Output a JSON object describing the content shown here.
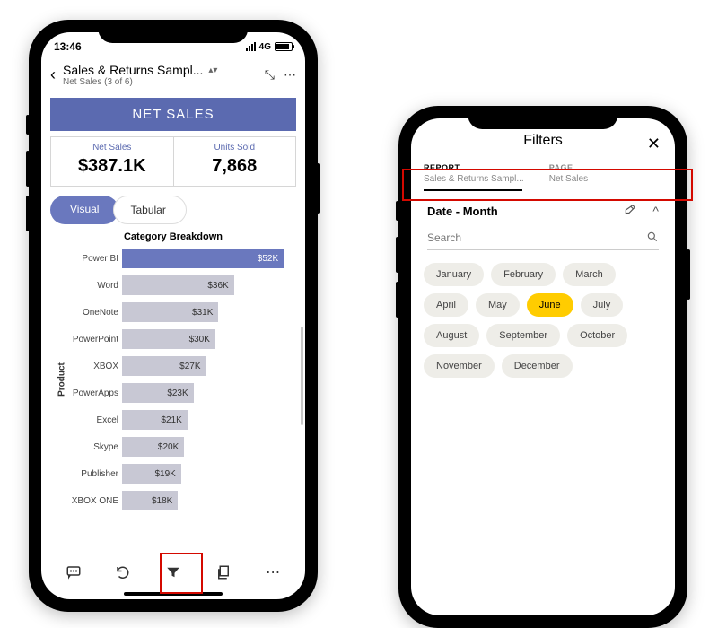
{
  "left": {
    "status": {
      "time": "13:46",
      "net": "4G"
    },
    "header": {
      "title": "Sales & Returns Sampl...",
      "subtitle": "Net Sales (3 of 6)"
    },
    "banner": "NET SALES",
    "kpis": [
      {
        "label": "Net Sales",
        "value": "$387.1K"
      },
      {
        "label": "Units Sold",
        "value": "7,868"
      }
    ],
    "toggle": {
      "visual": "Visual",
      "tabular": "Tabular",
      "active": "Visual"
    },
    "chart_title": "Category Breakdown",
    "y_axis_label": "Product"
  },
  "right": {
    "header": {
      "title": "Filters"
    },
    "tabs": {
      "report": {
        "label": "REPORT",
        "value": "Sales & Returns Sampl..."
      },
      "page": {
        "label": "PAGE",
        "value": "Net Sales"
      }
    },
    "field": {
      "name": "Date - Month"
    },
    "search": {
      "placeholder": "Search"
    },
    "months": [
      "January",
      "February",
      "March",
      "April",
      "May",
      "June",
      "July",
      "August",
      "September",
      "October",
      "November",
      "December"
    ],
    "selected": "June"
  },
  "chart_data": {
    "type": "bar",
    "title": "Category Breakdown",
    "xlabel": "",
    "ylabel": "Product",
    "categories": [
      "Power BI",
      "Word",
      "OneNote",
      "PowerPoint",
      "XBOX",
      "PowerApps",
      "Excel",
      "Skype",
      "Publisher",
      "XBOX ONE"
    ],
    "values": [
      52000,
      36000,
      31000,
      30000,
      27000,
      23000,
      21000,
      20000,
      19000,
      18000
    ],
    "value_labels": [
      "$52K",
      "$36K",
      "$31K",
      "$30K",
      "$27K",
      "$23K",
      "$21K",
      "$20K",
      "$19K",
      "$18K"
    ],
    "xlim": [
      0,
      56000
    ]
  }
}
